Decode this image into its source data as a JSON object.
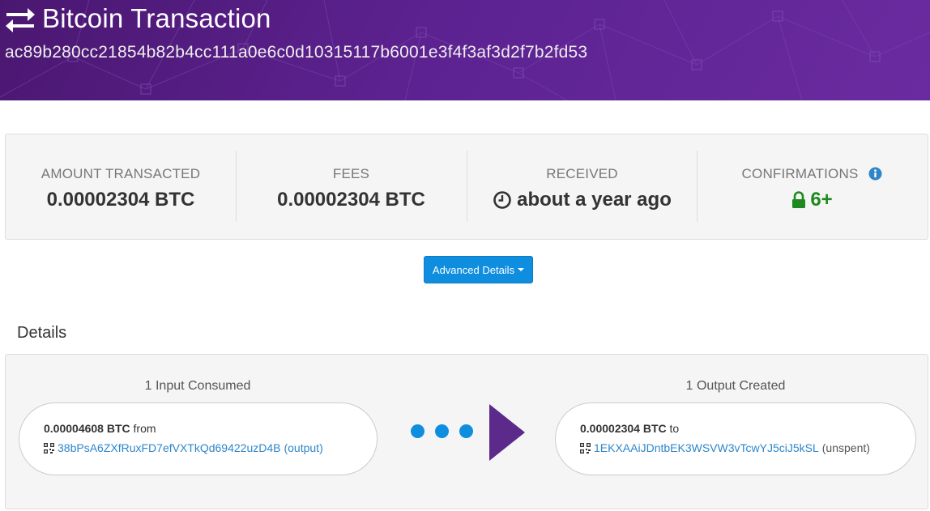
{
  "header": {
    "icon": "exchange-icon",
    "title": "Bitcoin Transaction",
    "txid": "ac89b280cc21854b82b4cc111a0e6c0d10315117b6001e3f4f3af3d2f7b2fd53"
  },
  "stats": {
    "amount": {
      "label": "AMOUNT TRANSACTED",
      "value": "0.00002304 BTC"
    },
    "fees": {
      "label": "FEES",
      "value": "0.00002304 BTC"
    },
    "received": {
      "label": "RECEIVED",
      "value": "about a year ago",
      "icon": "clock-icon"
    },
    "confirmations": {
      "label": "CONFIRMATIONS",
      "value": "6+",
      "icon": "lock-icon",
      "info_icon": "info-circle-icon",
      "color": "#1e8a1e"
    }
  },
  "advanced_button": {
    "label": "Advanced Details"
  },
  "details": {
    "heading": "Details",
    "inputs": {
      "heading": "1 Input Consumed",
      "items": [
        {
          "amount": "0.00004608 BTC",
          "word": "from",
          "address": "38bPsA6ZXfRuxFD7efVXTkQd69422uzD4B",
          "note": "(output)"
        }
      ]
    },
    "outputs": {
      "heading": "1 Output Created",
      "items": [
        {
          "amount": "0.00002304 BTC",
          "word": "to",
          "address": "1EKXAAiJDntbEK3WSVW3vTcwYJ5ciJ5kSL",
          "note": "(unspent)"
        }
      ]
    }
  },
  "colors": {
    "banner": "#5c2290",
    "accent": "#0f8ee0",
    "link": "#2e86c9",
    "arrow": "#5b2a8a",
    "green": "#1e8a1e"
  }
}
